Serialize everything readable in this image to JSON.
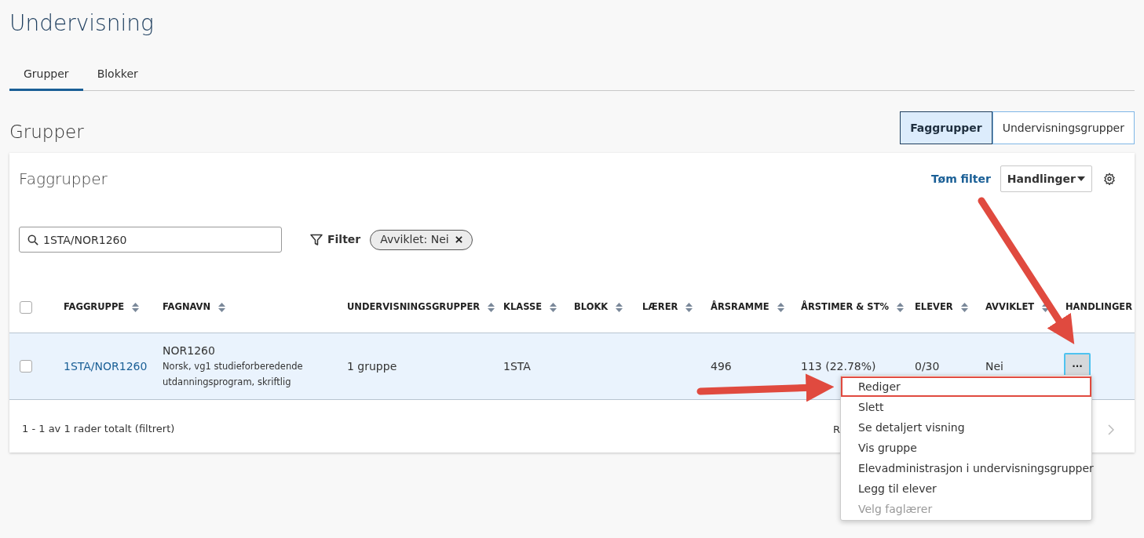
{
  "page_title": "Undervisning",
  "tabs": [
    {
      "label": "Grupper",
      "selected": true
    },
    {
      "label": "Blokker",
      "selected": false
    }
  ],
  "section_title": "Grupper",
  "view_toggle": [
    {
      "label": "Faggrupper",
      "selected": true
    },
    {
      "label": "Undervisningsgrupper",
      "selected": false
    }
  ],
  "card": {
    "title": "Faggrupper",
    "clear_filter": "Tøm filter",
    "actions_button": "Handlinger",
    "search": {
      "value": "1STA/NOR1260"
    },
    "filter_button": "Filter",
    "filter_chips": [
      {
        "label": "Avviklet: Nei"
      }
    ],
    "table": {
      "select_all_checked": false,
      "columns": [
        {
          "label": "FAGGRUPPE",
          "sortable": true
        },
        {
          "label": "FAGNAVN",
          "sortable": true
        },
        {
          "label": "UNDERVISNINGSGRUPPER",
          "sortable": true
        },
        {
          "label": "KLASSE",
          "sortable": true
        },
        {
          "label": "BLOKK",
          "sortable": true
        },
        {
          "label": "LÆRER",
          "sortable": true
        },
        {
          "label": "ÅRSRAMME",
          "sortable": true
        },
        {
          "label": "ÅRSTIMER & ST%",
          "sortable": true
        },
        {
          "label": "ELEVER",
          "sortable": true
        },
        {
          "label": "AVVIKLET",
          "sortable": true
        },
        {
          "label": "HANDLINGER",
          "sortable": false
        }
      ],
      "rows": [
        {
          "checked": false,
          "selected": true,
          "faggruppe": "1STA/NOR1260",
          "fagkode": "NOR1260",
          "fagnavn": "Norsk, vg1 studieforberedende utdanningsprogram, skriftlig",
          "undervisningsgrupper": "1 gruppe",
          "klasse": "1STA",
          "blokk": "",
          "laerer": "",
          "arsramme": "496",
          "arstimer": "113 (22.78%)",
          "elever": "0/30",
          "avviklet": "Nei",
          "actions_icon": "···"
        }
      ]
    },
    "footer": {
      "count": "1 - 1 av 1 rader totalt (filtrert)",
      "rows_label": "R"
    }
  },
  "row_menu": [
    {
      "label": "Rediger",
      "disabled": false,
      "highlighted": true
    },
    {
      "label": "Slett",
      "disabled": false,
      "highlighted": false
    },
    {
      "label": "Se detaljert visning",
      "disabled": false,
      "highlighted": false
    },
    {
      "label": "Vis gruppe",
      "disabled": false,
      "highlighted": false
    },
    {
      "label": "Elevadministrasjon i undervisningsgrupper",
      "disabled": false,
      "highlighted": false
    },
    {
      "label": "Legg til elever",
      "disabled": false,
      "highlighted": false
    },
    {
      "label": "Velg faglærer",
      "disabled": true,
      "highlighted": false
    }
  ]
}
